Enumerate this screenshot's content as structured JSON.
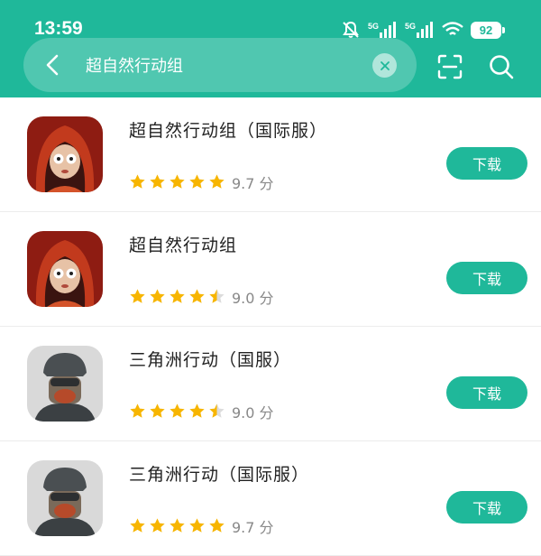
{
  "status_bar": {
    "time": "13:59",
    "signal_1": "5G",
    "signal_2": "5G",
    "battery": "92"
  },
  "search": {
    "query": "超自然行动组"
  },
  "colors": {
    "brand": "#1fb89a",
    "star": "#f7b500",
    "star_empty": "#dcdcdc"
  },
  "results": [
    {
      "name": "超自然行动组（国际服）",
      "rating": "9.7 分",
      "stars": 5,
      "button": "下载",
      "icon": "hooded-girl-app-icon"
    },
    {
      "name": "超自然行动组",
      "rating": "9.0 分",
      "stars": 4.5,
      "button": "下载",
      "icon": "hooded-girl-app-icon"
    },
    {
      "name": "三角洲行动（国服）",
      "rating": "9.0 分",
      "stars": 4.5,
      "button": "下载",
      "icon": "soldier-app-icon"
    },
    {
      "name": "三角洲行动（国际服）",
      "rating": "9.7 分",
      "stars": 5,
      "button": "下载",
      "icon": "soldier-app-icon"
    }
  ]
}
